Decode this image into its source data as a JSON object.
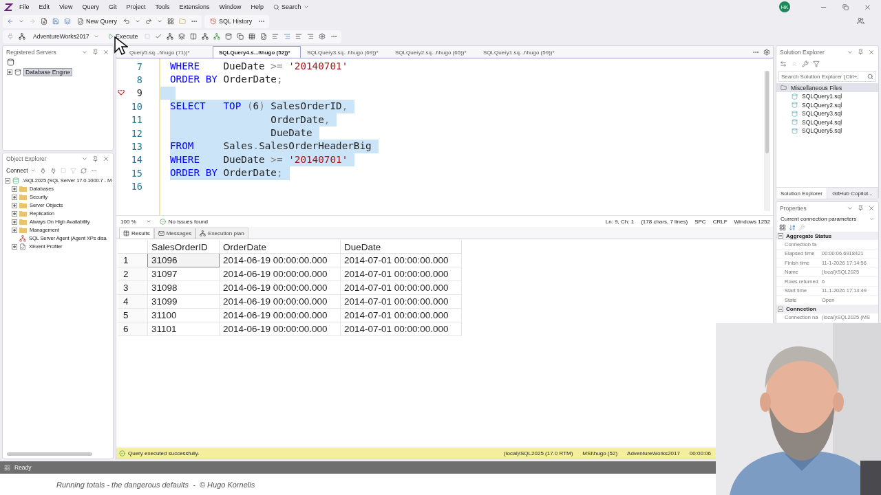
{
  "window": {
    "avatar": "HK"
  },
  "menu": [
    "File",
    "Edit",
    "View",
    "Query",
    "Git",
    "Project",
    "Tools",
    "Extensions",
    "Window",
    "Help"
  ],
  "menu_search": "Search",
  "toolbar": {
    "new_query": "New Query",
    "sql_history": "SQL History",
    "database": "AdventureWorks2017",
    "execute": "Execute"
  },
  "registered_servers": {
    "title": "Registered Servers",
    "items": [
      {
        "label": "Database Engine",
        "selected": true,
        "expanded": false
      }
    ]
  },
  "object_explorer": {
    "title": "Object Explorer",
    "connect": "Connect",
    "tree": [
      {
        "label": ".\\SQL2025 (SQL Server 17.0.1000.7 - M",
        "kind": "server",
        "expanded": true,
        "children": [
          {
            "label": "Databases",
            "kind": "folder",
            "expanded": false
          },
          {
            "label": "Security",
            "kind": "folder",
            "expanded": false
          },
          {
            "label": "Server Objects",
            "kind": "folder",
            "expanded": false
          },
          {
            "label": "Replication",
            "kind": "folder",
            "expanded": false
          },
          {
            "label": "Always On High Availability",
            "kind": "folder",
            "expanded": false
          },
          {
            "label": "Management",
            "kind": "folder",
            "expanded": false
          },
          {
            "label": "SQL Server Agent (Agent XPs disa",
            "kind": "agent"
          },
          {
            "label": "XEvent Profiler",
            "kind": "profiler",
            "expanded": false
          }
        ]
      }
    ]
  },
  "doc_tabs": [
    {
      "label": "Query5.sq...l\\hugo (71))*",
      "selected": false
    },
    {
      "label": "SQLQuery4.s...l\\hugo (52))*",
      "selected": true
    },
    {
      "label": "SQLQuery3.sq...l\\hugo (69))*",
      "selected": false
    },
    {
      "label": "SQLQuery2.sq...l\\hugo (65))*",
      "selected": false
    },
    {
      "label": "SQLQuery1.sq...l\\hugo (59))*",
      "selected": false
    }
  ],
  "editor": {
    "lines": [
      {
        "number": "7",
        "selected": false,
        "current": false,
        "marker": false,
        "tokens": [
          {
            "t": "WHERE",
            "kind": "kw"
          },
          {
            "t": "    DueDate ",
            "kind": "id"
          },
          {
            "t": ">=",
            "kind": "op"
          },
          {
            "t": " '20140701'",
            "kind": "str"
          }
        ]
      },
      {
        "number": "8",
        "selected": false,
        "current": false,
        "marker": false,
        "tokens": [
          {
            "t": "ORDER BY",
            "kind": "kw"
          },
          {
            "t": " OrderDate",
            "kind": "id"
          },
          {
            "t": ";",
            "kind": "op"
          }
        ]
      },
      {
        "number": "9",
        "selected": true,
        "current": true,
        "marker": true
      },
      {
        "number": "10",
        "selected": true,
        "current": false,
        "marker": false,
        "tokens": [
          {
            "t": "SELECT",
            "kind": "kw"
          },
          {
            "t": "   TOP",
            "kind": "kw"
          },
          {
            "t": " (",
            "kind": "op"
          },
          {
            "t": "6",
            "kind": "id"
          },
          {
            "t": ")",
            "kind": "op"
          },
          {
            "t": " SalesOrderID",
            "kind": "id"
          },
          {
            "t": ",",
            "kind": "op"
          }
        ]
      },
      {
        "number": "11",
        "selected": true,
        "current": false,
        "marker": false,
        "tokens": [
          {
            "t": "                 OrderDate",
            "kind": "id"
          },
          {
            "t": ",",
            "kind": "op"
          }
        ]
      },
      {
        "number": "12",
        "selected": true,
        "current": false,
        "marker": false,
        "tokens": [
          {
            "t": "                 DueDate",
            "kind": "id"
          }
        ]
      },
      {
        "number": "13",
        "selected": true,
        "current": false,
        "marker": false,
        "tokens": [
          {
            "t": "FROM",
            "kind": "kw"
          },
          {
            "t": "     Sales",
            "kind": "id"
          },
          {
            "t": ".",
            "kind": "op"
          },
          {
            "t": "SalesOrderHeaderBig",
            "kind": "id"
          }
        ]
      },
      {
        "number": "14",
        "selected": true,
        "current": false,
        "marker": false,
        "tokens": [
          {
            "t": "WHERE",
            "kind": "kw"
          },
          {
            "t": "    DueDate ",
            "kind": "id"
          },
          {
            "t": ">=",
            "kind": "op"
          },
          {
            "t": " '20140701'",
            "kind": "str"
          }
        ]
      },
      {
        "number": "15",
        "selected": true,
        "current": false,
        "marker": false,
        "tokens": [
          {
            "t": "ORDER BY",
            "kind": "kw"
          },
          {
            "t": " OrderDate",
            "kind": "id"
          },
          {
            "t": ";",
            "kind": "op"
          }
        ]
      },
      {
        "number": "16",
        "selected": false,
        "current": false,
        "marker": false
      }
    ]
  },
  "editor_status": {
    "zoom": "100 %",
    "issues": "No issues found",
    "position": "Ln: 9, Ch: 1",
    "selection": "(178 chars, 7 lines)",
    "whitespace": "SPC",
    "line_endings": "CRLF",
    "encoding": "Windows 1252"
  },
  "result_tabs": [
    {
      "label": "Results",
      "kind": "grid",
      "selected": true
    },
    {
      "label": "Messages",
      "kind": "messages",
      "selected": false
    },
    {
      "label": "Execution plan",
      "kind": "plan",
      "selected": false
    }
  ],
  "results": {
    "columns": [
      "SalesOrderID",
      "OrderDate",
      "DueDate"
    ],
    "rows": [
      {
        "number": "1",
        "focused": true,
        "cells": [
          "31096",
          "2014-06-19 00:00:00.000",
          "2014-07-01 00:00:00.000"
        ]
      },
      {
        "number": "2",
        "focused": false,
        "cells": [
          "31097",
          "2014-06-19 00:00:00.000",
          "2014-07-01 00:00:00.000"
        ]
      },
      {
        "number": "3",
        "focused": false,
        "cells": [
          "31098",
          "2014-06-19 00:00:00.000",
          "2014-07-01 00:00:00.000"
        ]
      },
      {
        "number": "4",
        "focused": false,
        "cells": [
          "31099",
          "2014-06-19 00:00:00.000",
          "2014-07-01 00:00:00.000"
        ]
      },
      {
        "number": "5",
        "focused": false,
        "cells": [
          "31100",
          "2014-06-19 00:00:00.000",
          "2014-07-01 00:00:00.000"
        ]
      },
      {
        "number": "6",
        "focused": false,
        "cells": [
          "31101",
          "2014-06-19 00:00:00.000",
          "2014-07-01 00:00:00.000"
        ]
      }
    ]
  },
  "query_status": {
    "message": "Query executed successfully.",
    "server": "(local)\\SQL2025 (17.0 RTM)",
    "user": "MSI\\hugo (52)",
    "database": "AdventureWorks2017",
    "elapsed": "00:00:06"
  },
  "solution_explorer": {
    "title": "Solution Explorer",
    "search_placeholder": "Search Solution Explorer (Ctrl+;",
    "tree": [
      {
        "label": "Miscellaneous Files",
        "selected": true,
        "children": [
          {
            "label": "SQLQuery1.sql",
            "selected": false
          },
          {
            "label": "SQLQuery2.sql",
            "selected": false
          },
          {
            "label": "SQLQuery3.sql",
            "selected": false
          },
          {
            "label": "SQLQuery4.sql",
            "selected": false
          },
          {
            "label": "SQLQuery5.sql",
            "selected": false
          }
        ]
      }
    ],
    "tabs": [
      {
        "label": "Solution Explorer",
        "selected": true
      },
      {
        "label": "GitHub Copilot...",
        "selected": false
      }
    ]
  },
  "properties": {
    "title": "Properties",
    "object": "Current connection parameters",
    "categories": [
      {
        "name": "Aggregate Status",
        "expanded": true,
        "rows": [
          {
            "name": "Connection fa"
          },
          {
            "name": "Elapsed time",
            "value": "00:00:06.6918421"
          },
          {
            "name": "Finish time",
            "value": "11-1-2026 17:14:56"
          },
          {
            "name": "Name",
            "value": "(local)\\SQL2025"
          },
          {
            "name": "Rows returned",
            "value": "6"
          },
          {
            "name": "Start time",
            "value": "11-1-2026 17:14:49"
          },
          {
            "name": "State",
            "value": "Open"
          }
        ]
      },
      {
        "name": "Connection",
        "expanded": true,
        "rows": [
          {
            "name": "Connection na",
            "value": "(local)\\SQL2025 (MS"
          }
        ]
      }
    ]
  },
  "status_bar": {
    "text": "Ready"
  },
  "caption": "Running totals - the dangerous defaults  -  © Hugo Kornelis"
}
